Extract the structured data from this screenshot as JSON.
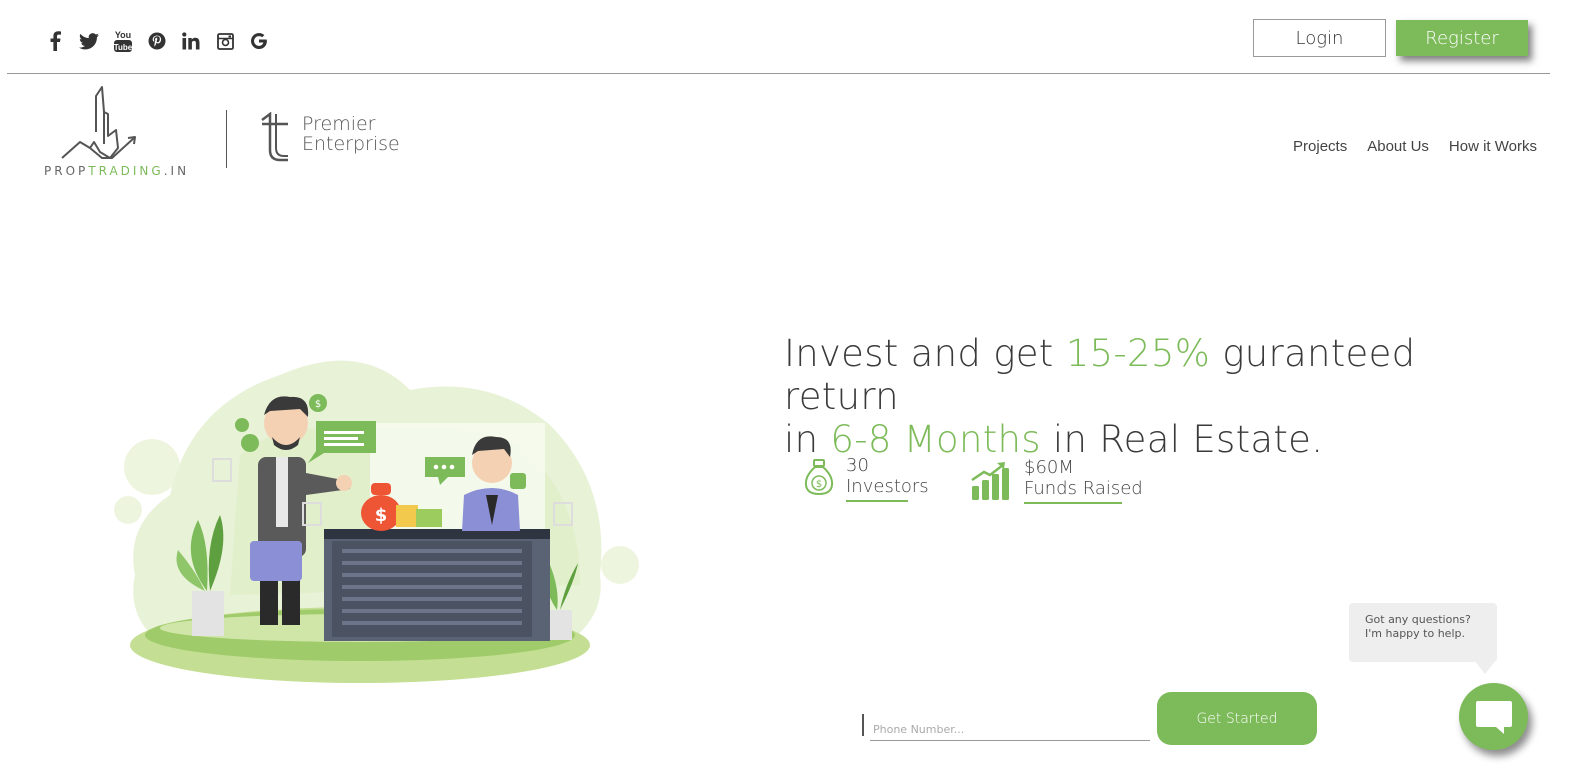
{
  "social": {
    "icons": [
      "facebook-icon",
      "twitter-icon",
      "youtube-icon",
      "pinterest-icon",
      "linkedin-icon",
      "instagram-icon",
      "google-icon"
    ],
    "youtube_text": "You Tube"
  },
  "auth": {
    "login_label": "Login",
    "register_label": "Register"
  },
  "brand": {
    "logo_text_prefix": "PROP",
    "logo_text_accent": "TRADING",
    "logo_text_suffix": ".IN",
    "partner_line1": "Premier",
    "partner_line2": "Enterprise"
  },
  "nav": {
    "items": [
      "Projects",
      "About Us",
      "How it Works"
    ]
  },
  "hero": {
    "line1_a": "Invest and get ",
    "line1_b": "15-25%",
    "line1_c": " guranteed return",
    "line2_a": "in ",
    "line2_b": "6-8 Months",
    "line2_c": " in Real Estate."
  },
  "stats": [
    {
      "value": "30",
      "label": "Investors",
      "icon": "money-bag-icon"
    },
    {
      "value": "$60M",
      "label": "Funds Raised",
      "icon": "growth-chart-icon"
    }
  ],
  "form": {
    "phone_placeholder": "Phone Number...",
    "phone_value": "",
    "submit_label": "Get Started"
  },
  "chat": {
    "line1": "Got any questions?",
    "line2": "I'm happy to help."
  },
  "colors": {
    "accent": "#7dbb5a",
    "text": "#3a3a3a"
  }
}
